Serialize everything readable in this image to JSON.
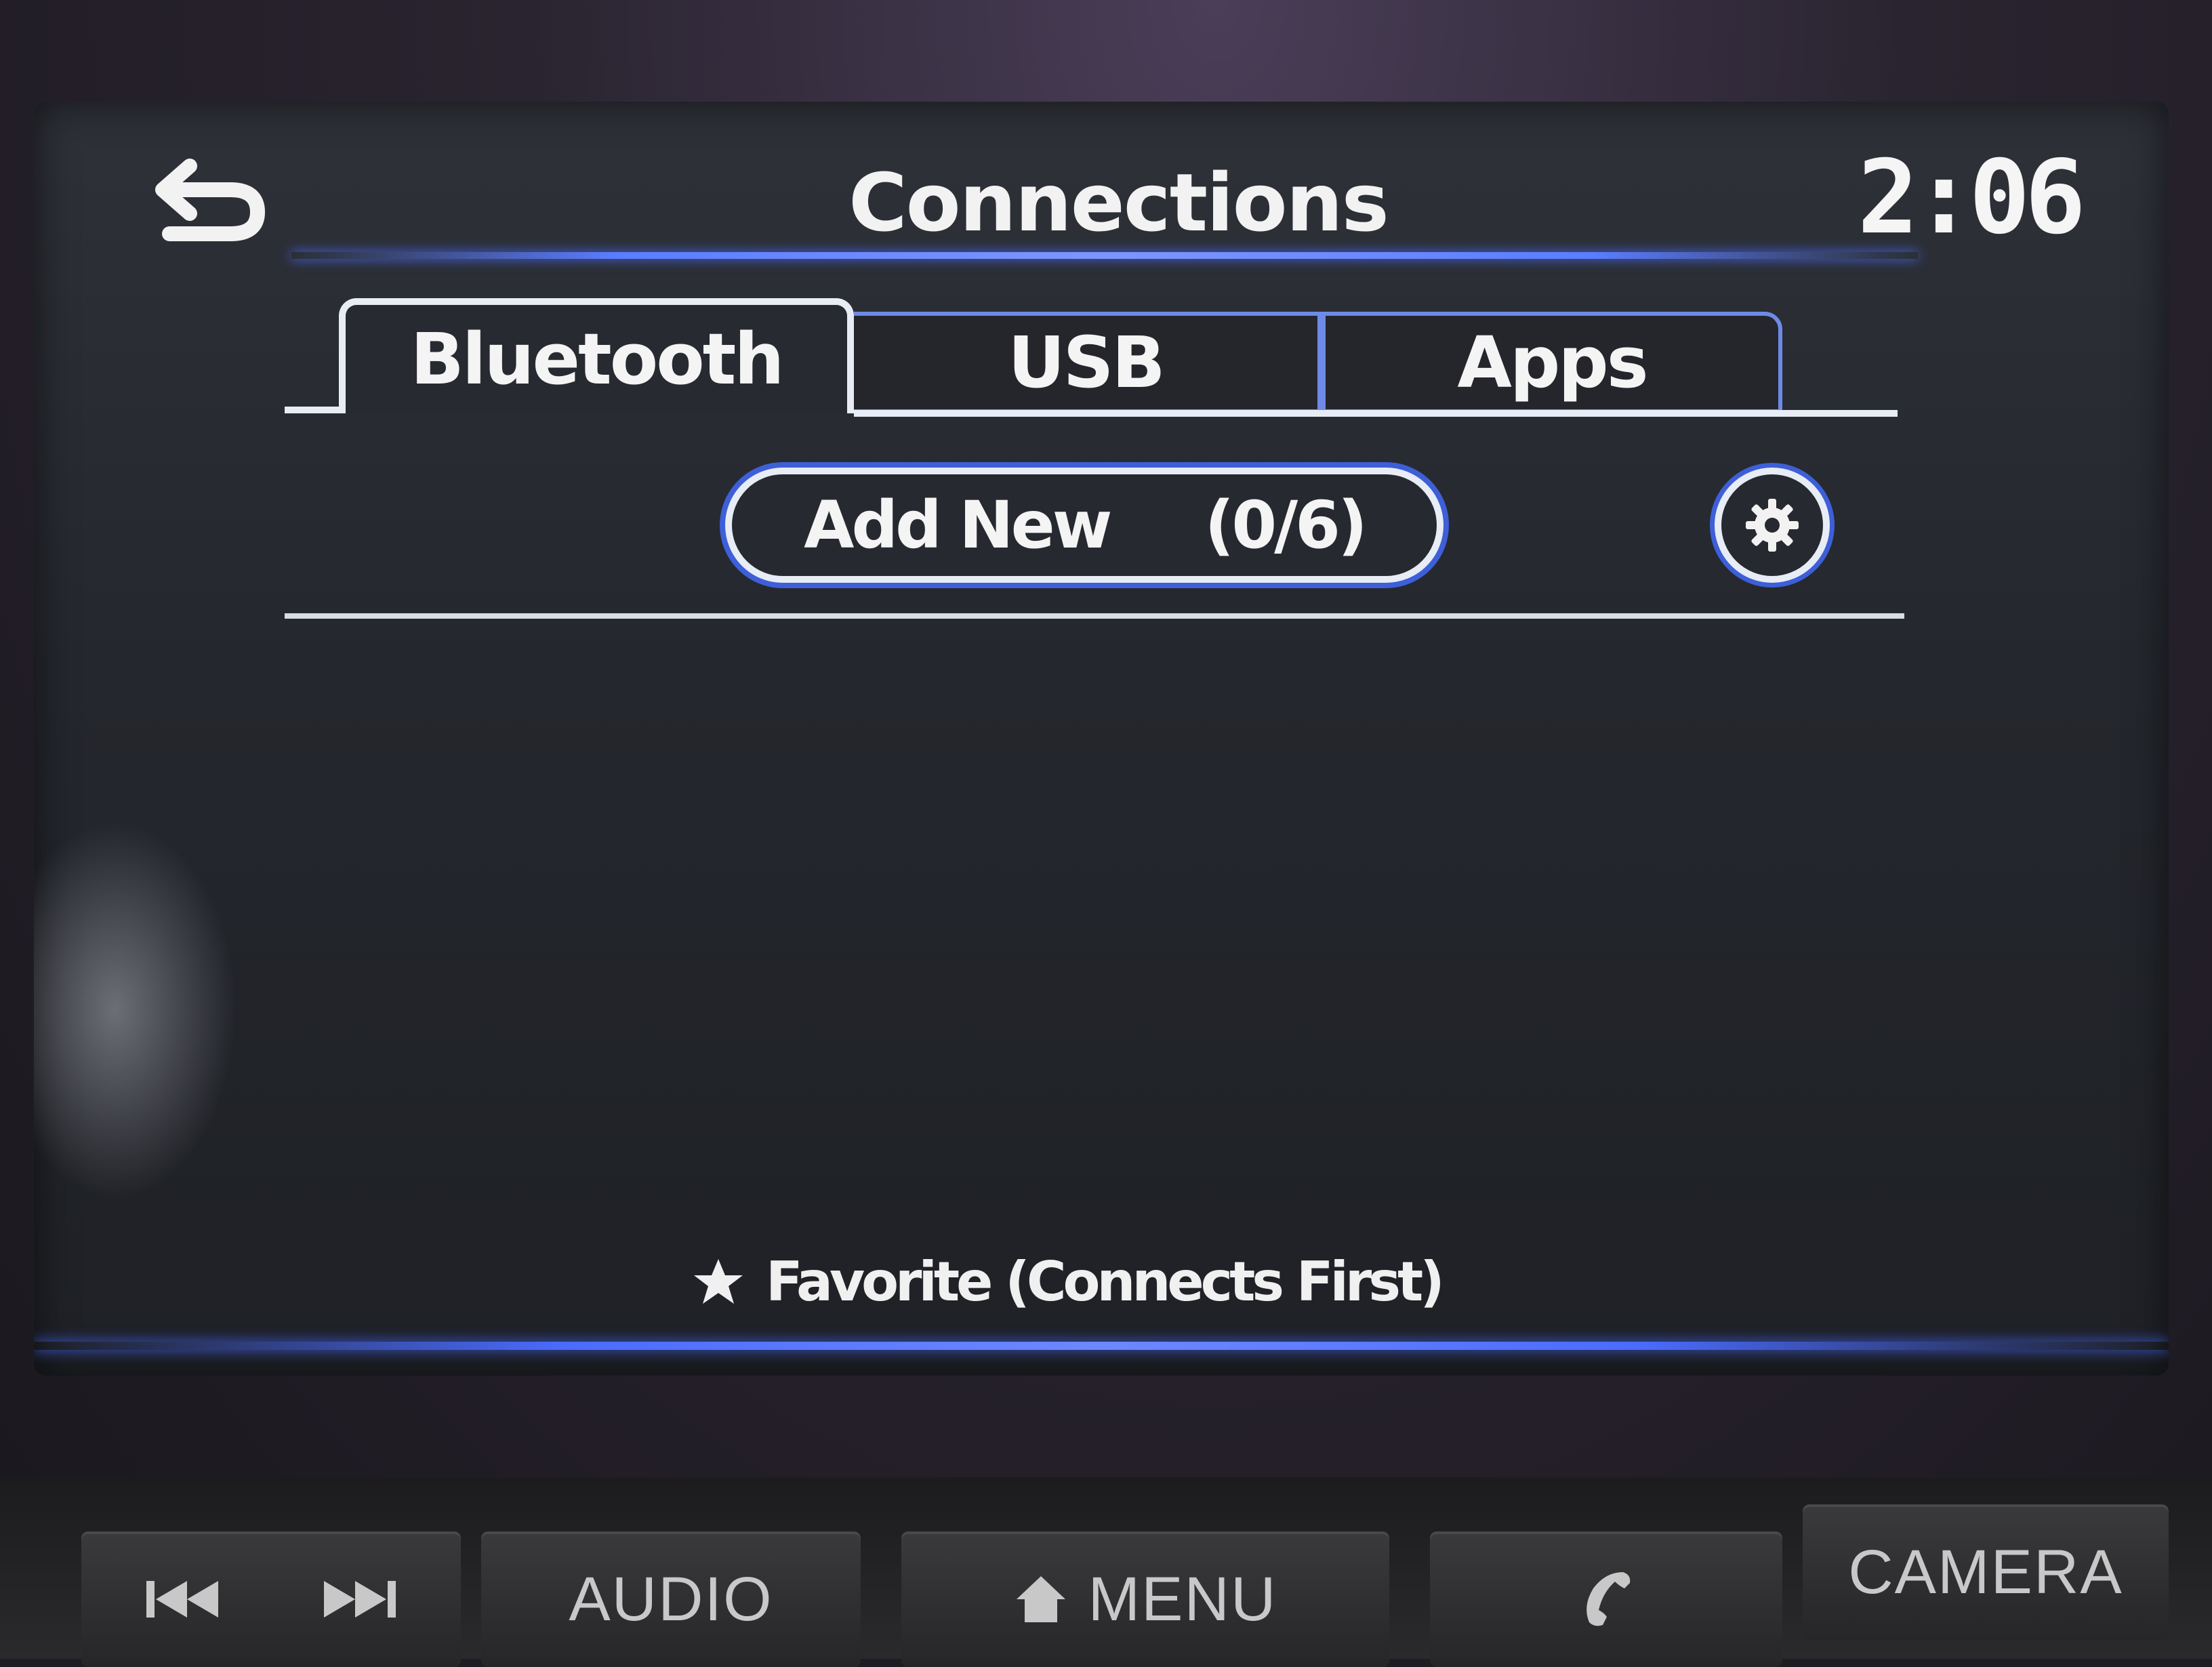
{
  "header": {
    "title": "Connections",
    "clock": "2:06"
  },
  "tabs": [
    {
      "label": "Bluetooth",
      "active": true
    },
    {
      "label": "USB",
      "active": false
    },
    {
      "label": "Apps",
      "active": false
    }
  ],
  "bluetooth": {
    "add_new_label": "Add New",
    "add_new_count": "(0/6)"
  },
  "footer": {
    "hint": "Favorite (Connects First)"
  },
  "hardware_buttons": {
    "audio": "AUDIO",
    "menu": "MENU",
    "camera": "CAMERA"
  },
  "colors": {
    "accent_blue": "#5b7dff",
    "outline_white": "#e8ecf5",
    "screen_bg": "#24272d"
  },
  "icons": {
    "back": "back-arrow-icon",
    "settings": "gear-icon",
    "favorite": "star-icon",
    "prev_track": "skip-previous-icon",
    "next_track": "skip-next-icon",
    "home": "home-icon",
    "phone": "phone-icon"
  }
}
